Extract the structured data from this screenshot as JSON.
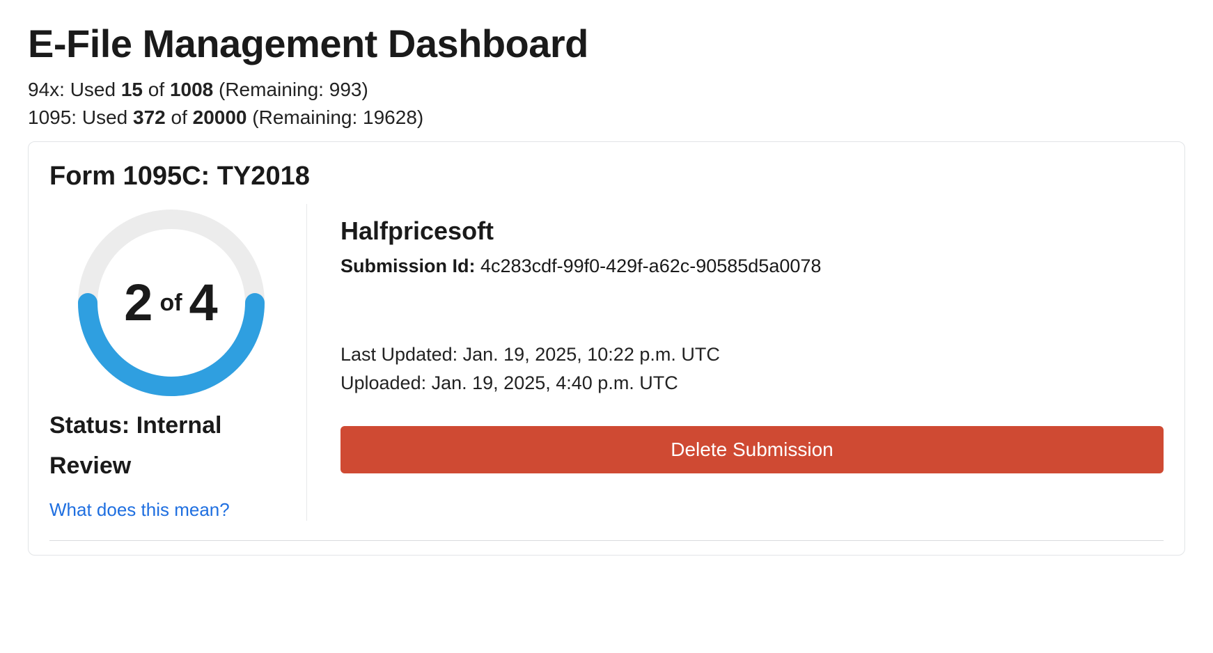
{
  "header": {
    "title": "E-File Management Dashboard"
  },
  "usage": {
    "line1_prefix": "94x: Used ",
    "line1_used": "15",
    "line1_of": " of ",
    "line1_total": "1008",
    "line1_remaining": " (Remaining: 993)",
    "line2_prefix": "1095: Used ",
    "line2_used": "372",
    "line2_of": " of ",
    "line2_total": "20000",
    "line2_remaining": " (Remaining: 19628)"
  },
  "card": {
    "title": "Form 1095C: TY2018",
    "progress": {
      "current": "2",
      "of_word": "of",
      "total": "4"
    },
    "status_label": "Status: ",
    "status_value": "Internal Review",
    "help_link": "What does this mean?",
    "org_name": "Halfpricesoft",
    "submission_label": "Submission Id:",
    "submission_id": " 4c283cdf-99f0-429f-a62c-90585d5a0078",
    "last_updated_label": "Last Updated: ",
    "last_updated_value": "Jan. 19, 2025, 10:22 p.m. UTC",
    "uploaded_label": "Uploaded: ",
    "uploaded_value": "Jan. 19, 2025, 4:40 p.m. UTC",
    "delete_label": "Delete Submission"
  }
}
